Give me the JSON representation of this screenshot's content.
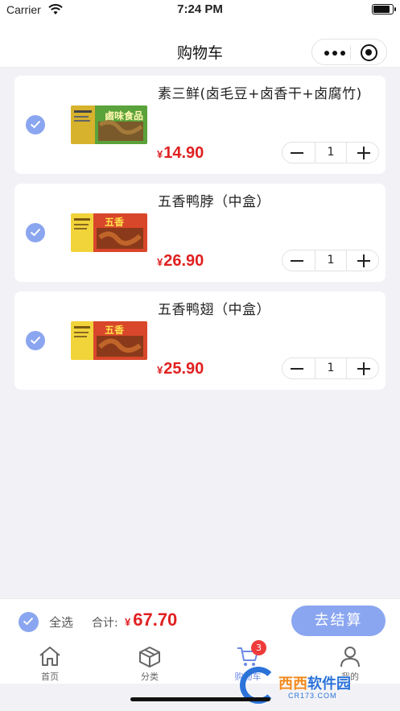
{
  "status_bar": {
    "carrier": "Carrier",
    "time": "7:24 PM"
  },
  "nav": {
    "title": "购物车"
  },
  "cart": {
    "items": [
      {
        "name": "素三鲜(卤毛豆+卤香干+卤腐竹)",
        "currency": "¥",
        "price": "14.90",
        "quantity": "1",
        "checked": true,
        "image_label": "鹵味食品"
      },
      {
        "name": "五香鸭脖（中盒）",
        "currency": "¥",
        "price": "26.90",
        "quantity": "1",
        "checked": true,
        "image_label": "五香"
      },
      {
        "name": "五香鸭翅（中盒）",
        "currency": "¥",
        "price": "25.90",
        "quantity": "1",
        "checked": true,
        "image_label": "五香"
      }
    ]
  },
  "footer": {
    "select_all_label": "全选",
    "total_label": "合计:",
    "currency": "¥",
    "total_value": "67.70",
    "checkout_label": "去结算"
  },
  "tabbar": {
    "tabs": [
      {
        "label": "首页",
        "icon": "home-icon"
      },
      {
        "label": "分类",
        "icon": "box-icon"
      },
      {
        "label": "购物车",
        "icon": "cart-icon",
        "badge": "3",
        "active": true
      },
      {
        "label": "我的",
        "icon": "user-icon"
      }
    ]
  },
  "watermark": {
    "title_a": "西西",
    "title_b": "软件园",
    "sub": "CR173.COM"
  },
  "colors": {
    "accent": "#8ba6f0",
    "price": "#e02020",
    "badge": "#ee3b3b",
    "active_tab": "#6e8ae6"
  }
}
